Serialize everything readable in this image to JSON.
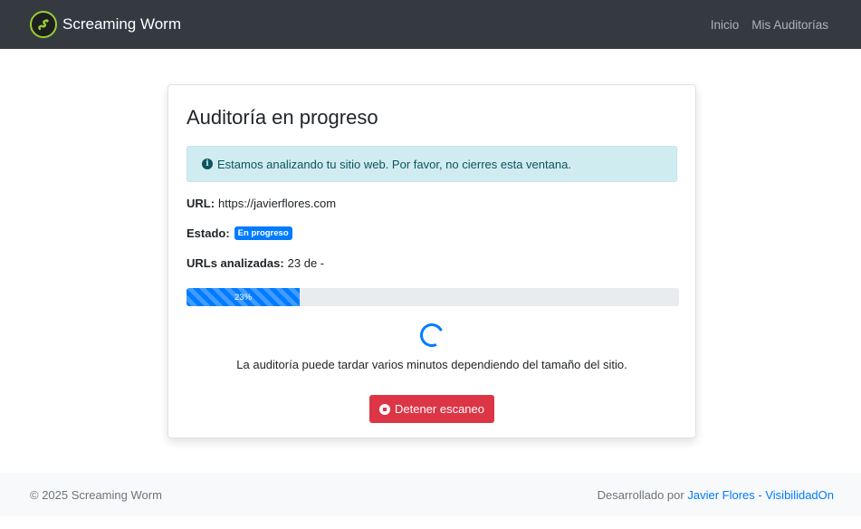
{
  "navbar": {
    "brand": "Screaming Worm",
    "links": [
      "Inicio",
      "Mis Auditorías"
    ]
  },
  "card": {
    "title": "Auditoría en progreso",
    "alert": "Estamos analizando tu sitio web. Por favor, no cierres esta ventana.",
    "url_label": "URL:",
    "url_value": "https://javierflores.com",
    "status_label": "Estado:",
    "status_badge": "En progreso",
    "urls_label": "URLs analizadas:",
    "urls_value": "23 de -",
    "progress_text": "23%",
    "progress_value": 23,
    "note": "La auditoría puede tardar varios minutos dependiendo del tamaño del sitio.",
    "stop_button": "Detener escaneo"
  },
  "footer": {
    "copyright": "© 2025 Screaming Worm",
    "developed_by": "Desarrollado por",
    "author": "Javier Flores",
    "separator": "-",
    "company": "VisibilidadOn"
  },
  "colors": {
    "navbar": "#343a40",
    "primary": "#007bff",
    "danger": "#dc3545",
    "info_bg": "#d1ecf1",
    "info_text": "#0c5460"
  },
  "icons": {
    "brand": "worm-logo-icon",
    "alert": "info-circle-icon",
    "loading": "spinner-icon",
    "stop": "stop-circle-icon"
  }
}
